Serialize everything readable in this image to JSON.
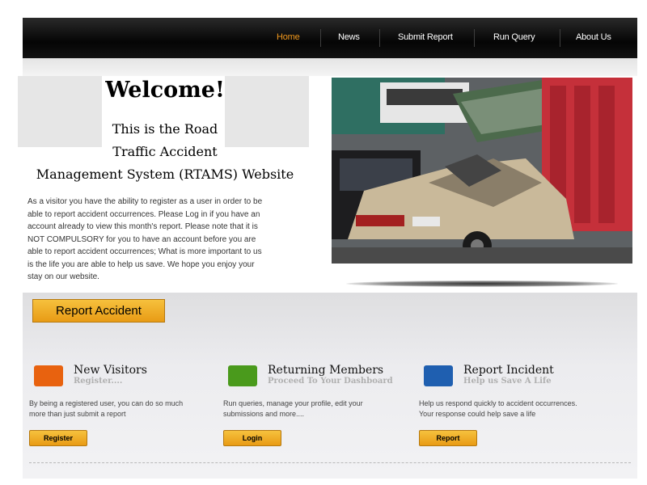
{
  "nav": {
    "items": [
      "Home",
      "News",
      "Submit Report",
      "Run Query",
      "About Us"
    ],
    "active": "Home"
  },
  "welcome": {
    "title": "Welcome!",
    "subtitle_lines": [
      "This is the Road",
      "Traffic Accident",
      "Management System (RTAMS) Website"
    ],
    "body_lines": [
      "As a visitor you have the ability to register as a user in order to be",
      "able to report accident occurrences. Please Log in if you have an",
      "account already to view this month's report. Please note that it is",
      "NOT COMPULSORY for you to have an account before you are",
      "able to report accident occurrences; What is more important to us",
      "is the life you are able to help us save. We hope you enjoy your",
      "stay on our website."
    ]
  },
  "report_accident_button": "Report Accident",
  "columns": [
    {
      "title": "New Visitors",
      "subtitle": "Register....",
      "desc_lines": [
        "By being a registered user, you can do so much",
        "more than just submit a report"
      ],
      "button": "Register",
      "icon": "orange-briefcase-icon",
      "icon_color": "#e8620f"
    },
    {
      "title": "Returning Members",
      "subtitle": "Proceed To Your Dashboard",
      "desc_lines": [
        "Run queries, manage your profile, edit your",
        "submissions and more...."
      ],
      "button": "Login",
      "icon": "green-briefcase-icon",
      "icon_color": "#4a9a1c"
    },
    {
      "title": "Report Incident",
      "subtitle": "Help us Save A Life",
      "desc_lines": [
        "Help us respond quickly to accident occurrences.",
        "Your response could help save a life"
      ],
      "button": "Report",
      "icon": "blue-briefcase-icon",
      "icon_color": "#1f5fb0"
    }
  ],
  "colors": {
    "nav_active": "#f39a1e",
    "button_orange": "#f0ab25",
    "navbar_bg": "#0a0a0a"
  }
}
